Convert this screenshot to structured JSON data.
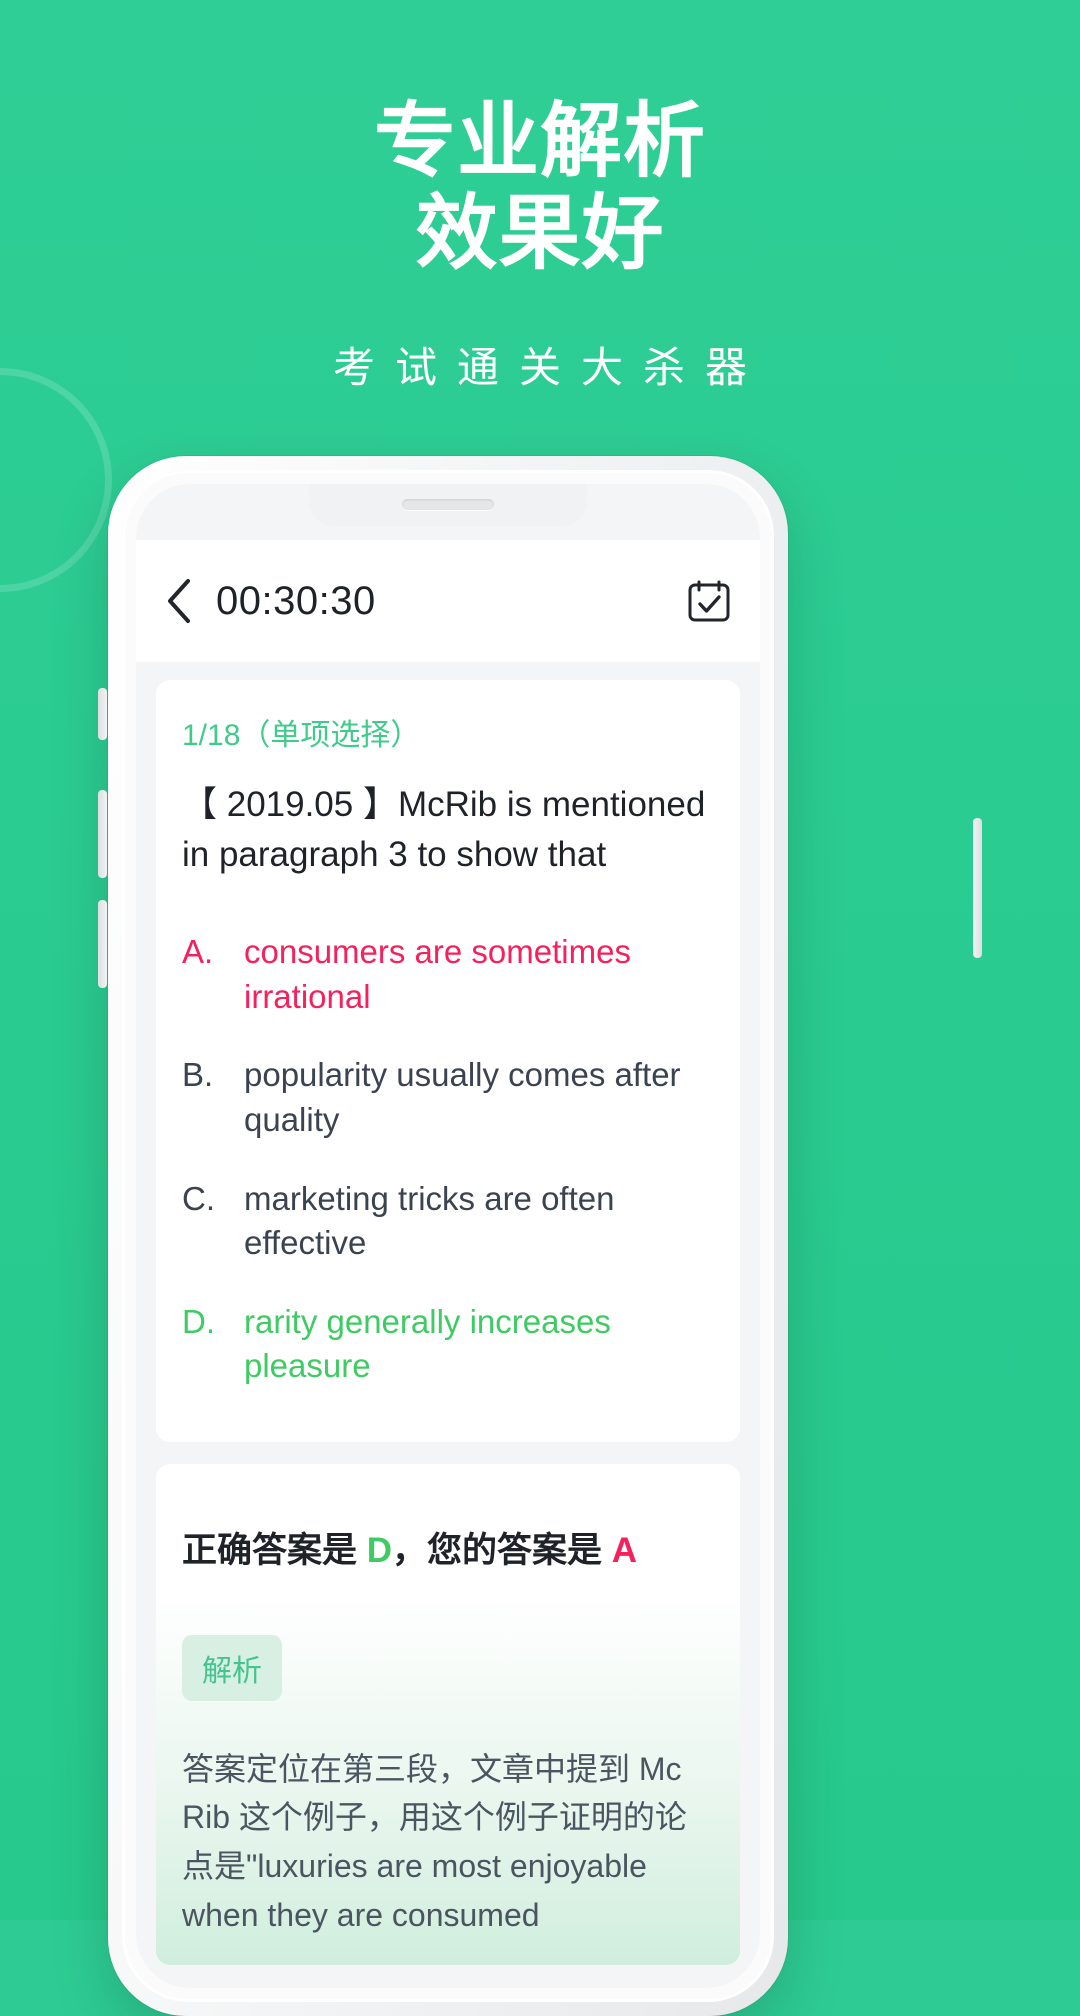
{
  "promo": {
    "headline_line1": "专业解析",
    "headline_line2": "效果好",
    "subtitle": "考试通关大杀器",
    "brand_green": "#2ECC94"
  },
  "app": {
    "appbar": {
      "back_icon": "chevron-left-icon",
      "timer": "00:30:30",
      "right_icon": "answer-card-icon"
    },
    "question": {
      "meta": "1/18（单项选择）",
      "text": "【 2019.05 】McRib is mentioned in paragraph 3 to show that",
      "options": [
        {
          "letter": "A.",
          "text": "consumers are sometimes irrational",
          "state": "wrong"
        },
        {
          "letter": "B.",
          "text": "popularity usually comes after quality",
          "state": "normal"
        },
        {
          "letter": "C.",
          "text": "marketing tricks are often effective",
          "state": "normal"
        },
        {
          "letter": "D.",
          "text": "rarity generally increases pleasure",
          "state": "right"
        }
      ]
    },
    "answer": {
      "prefix": "正确答案是 ",
      "correct": "D",
      "middle": "，您的答案是 ",
      "user": "A",
      "tag": "解析",
      "explanation": "答案定位在第三段，文章中提到 Mc Rib 这个例子，用这个例子证明的论点是\"luxuries are most enjoyable when they are consumed"
    },
    "colors": {
      "accent_green": "#3FCB8A",
      "correct_green": "#3FCB63",
      "wrong_pink": "#F5215C",
      "text_dark": "#1f2329"
    }
  }
}
